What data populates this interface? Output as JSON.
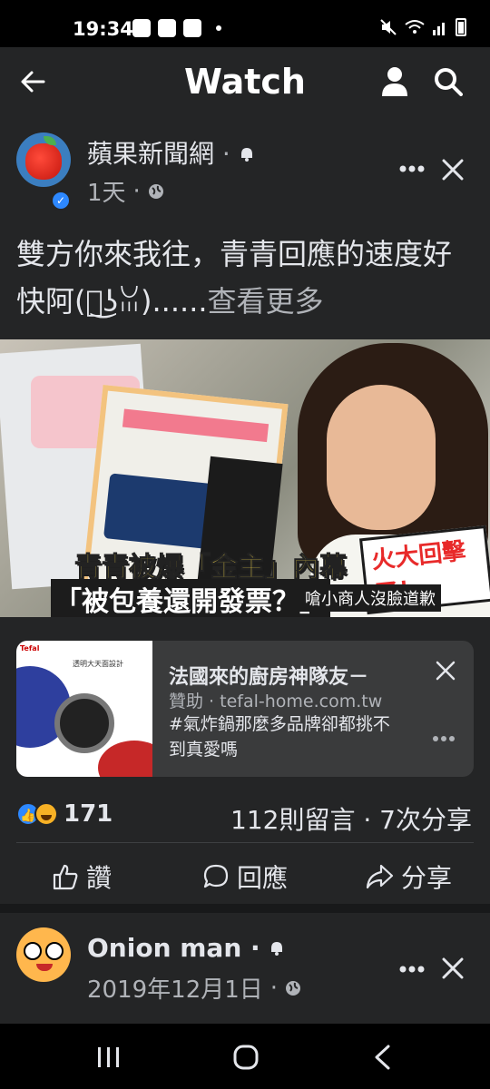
{
  "status_bar": {
    "time": "19:34"
  },
  "header": {
    "title": "Watch"
  },
  "post": {
    "page_name": "蘋果新聞網",
    "name_separator": "·",
    "time_ago": "1天",
    "meta_separator": "·",
    "text": "雙方你來我往，青青回應的速度好快阿(ꈍ͜ʖꈍ)......",
    "see_more": "查看更多",
    "image_headline": "青青被爆「金主」內幕",
    "image_headline2": "「被包養還開發票？」",
    "image_caption": "嗆小商人沒臉道歉",
    "image_burst": "火大回擊了！"
  },
  "ad": {
    "title": "法國來的廚房神隊友－",
    "sponsor_label": "贊助 · tefal-home.com.tw",
    "body": "#氣炸鍋那麼多品牌卻都挑不到真愛嗎",
    "thumb_brand": "Tefal",
    "thumb_tagline": "透明大天面設計"
  },
  "engagement": {
    "reaction_count": "171",
    "comments_shares": "112則留言 · 7次分享"
  },
  "actions": {
    "like": "讚",
    "comment": "回應",
    "share": "分享"
  },
  "post2": {
    "name": "Onion man",
    "name_separator": "·",
    "date": "2019年12月1日",
    "meta_separator": "·"
  },
  "colors": {
    "background": "#18191a",
    "card": "#242526",
    "accent": "#2d88ff"
  }
}
